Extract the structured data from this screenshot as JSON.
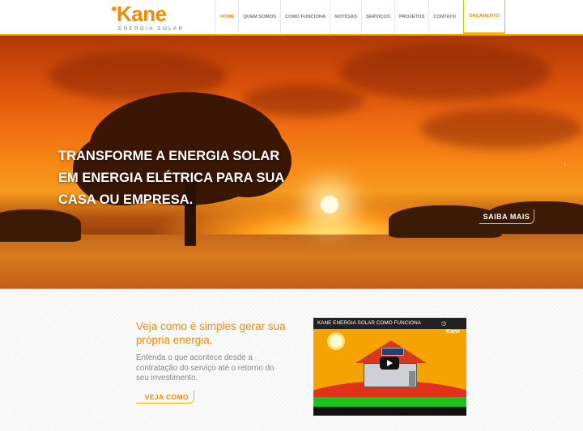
{
  "brand": {
    "name": "Kane",
    "tagline": "ENERGIA SOLAR",
    "accent_color": "#f28a00",
    "line_color": "#f4b400"
  },
  "nav": {
    "items": [
      {
        "label": "HOME",
        "active": true
      },
      {
        "label": "QUEM SOMOS",
        "active": false
      },
      {
        "label": "COMO FUNCIONA",
        "active": false
      },
      {
        "label": "NOTÍCIAS",
        "active": false
      },
      {
        "label": "SERVIÇOS",
        "active": false
      },
      {
        "label": "PROJETOS",
        "active": false
      },
      {
        "label": "CONTATO",
        "active": false
      }
    ],
    "cta_label": "ORÇAMENTO"
  },
  "hero": {
    "title": "TRANSFORME A ENERGIA SOLAR EM ENERGIA ELÉTRICA PARA SUA CASA OU EMPRESA.",
    "button_label": "SAIBA MAIS",
    "next_icon": "chevron-right-icon"
  },
  "section": {
    "title": "Veja como é simples gerar sua própria energia.",
    "text": "Entenda o que acontece desde a contratação do serviço até o retorno do seu investimento.",
    "button_label": "VEJA COMO"
  },
  "video": {
    "title": "KANE ENERGIA SOLAR COMO FUNCIONA",
    "logo": "Kane",
    "play_icon": "play-icon"
  }
}
